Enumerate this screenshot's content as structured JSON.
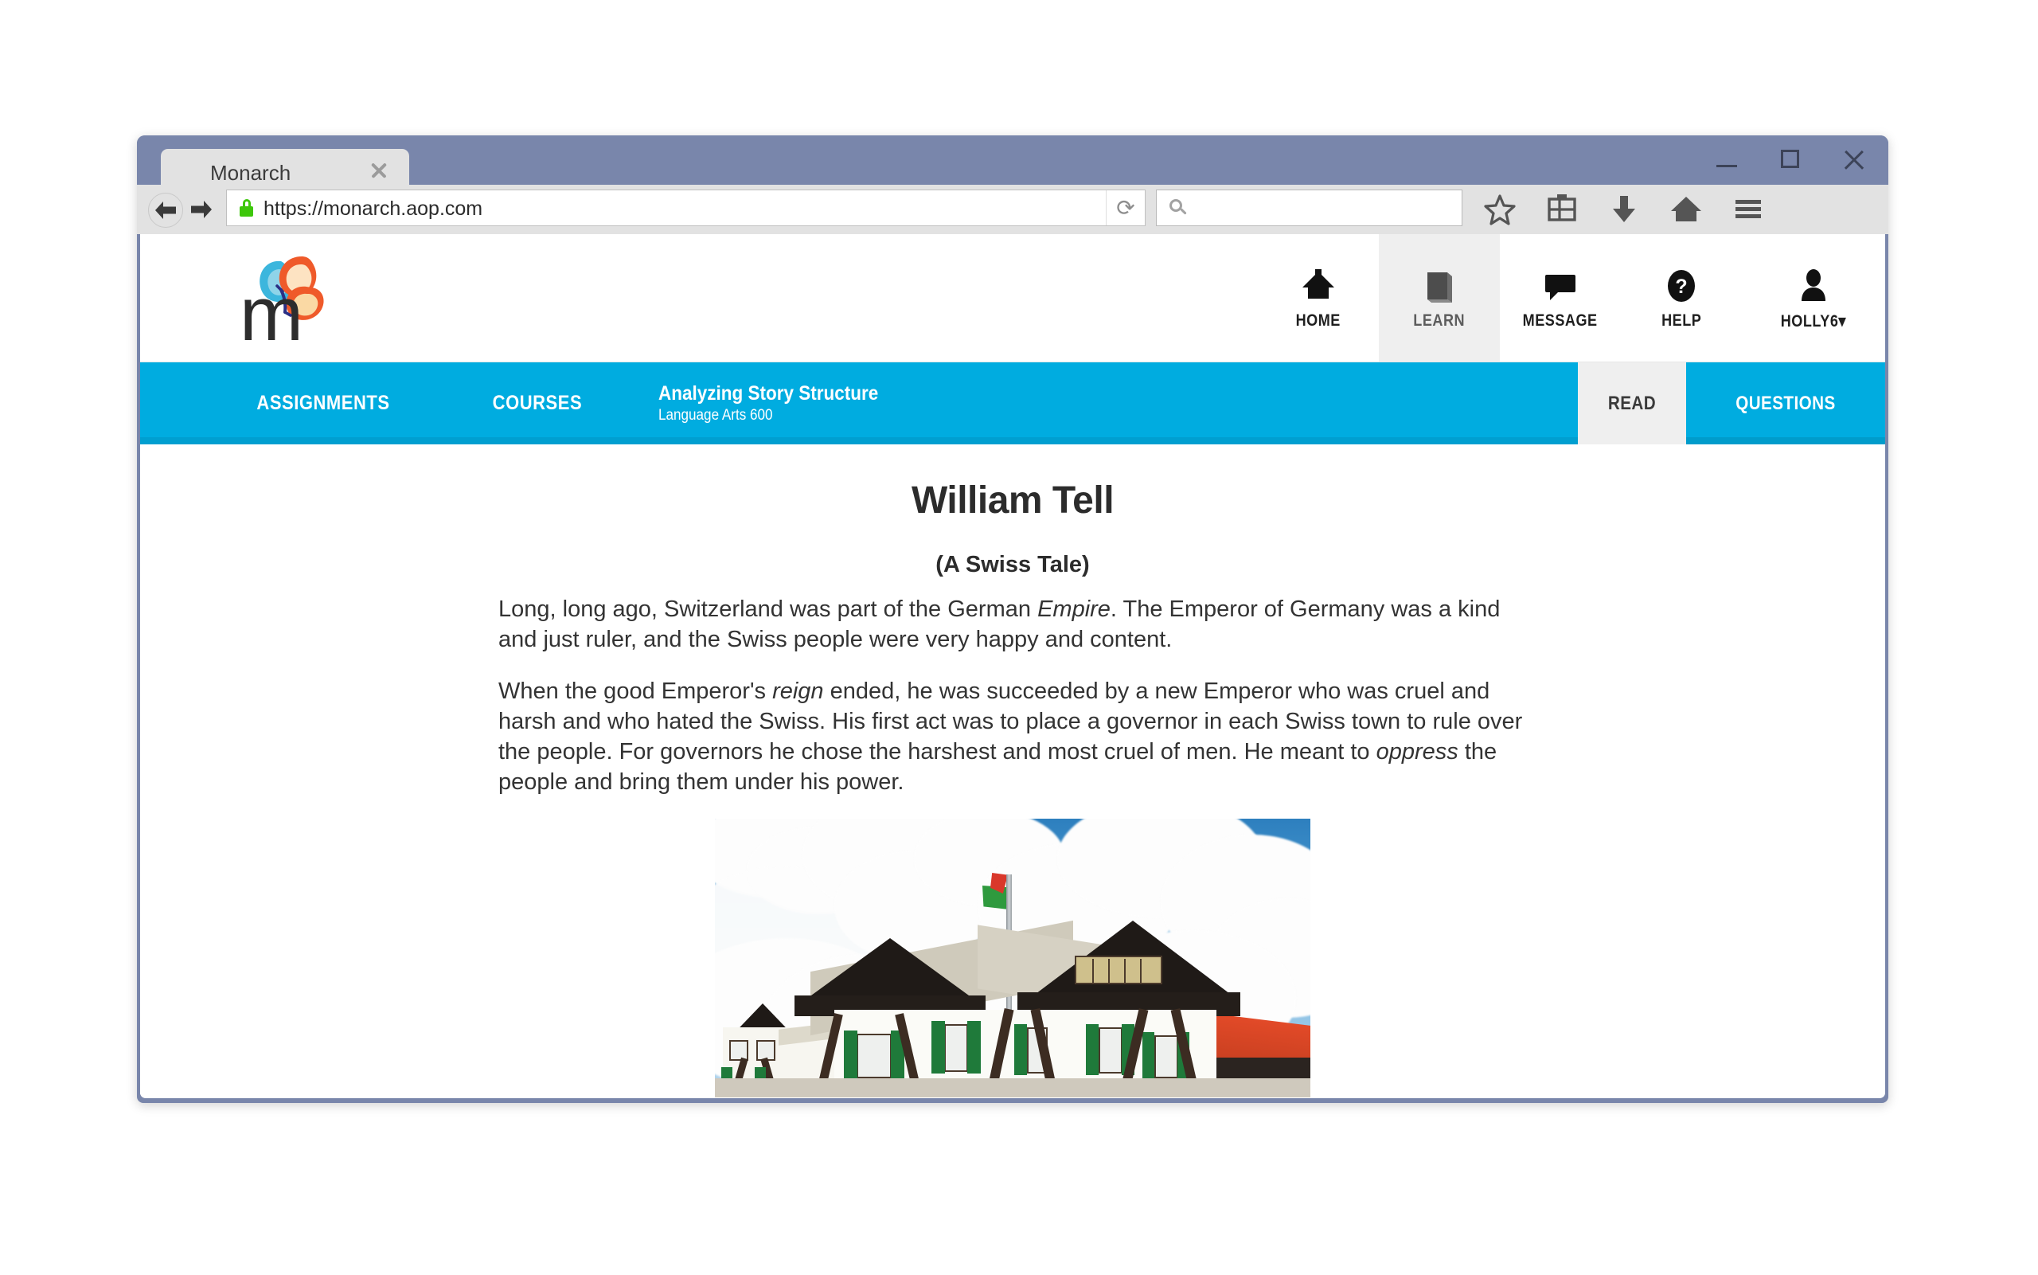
{
  "browser": {
    "tab": {
      "title": "Monarch",
      "close_icon": "close-icon"
    },
    "window_controls": {
      "minimize": "minimize-icon",
      "maximize": "maximize-icon",
      "close": "close-icon"
    },
    "navigation": {
      "back_icon": "back-arrow-icon",
      "forward_icon": "forward-arrow-icon",
      "reload_icon": "reload-icon"
    },
    "address_bar": {
      "url": "https://monarch.aop.com",
      "lock_icon": "lock-icon",
      "secure": "Secure"
    },
    "search": {
      "value": "",
      "placeholder": "",
      "icon": "search-icon"
    },
    "toolbar_icons": [
      "bookmark-star-icon",
      "library-icon",
      "download-icon",
      "home-icon",
      "menu-icon"
    ]
  },
  "site": {
    "logo": {
      "letter": "m",
      "icon": "butterfly-icon",
      "brand": "Monarch"
    },
    "header_nav": [
      {
        "label": "HOME",
        "icon": "home-icon",
        "active": false
      },
      {
        "label": "LEARN",
        "icon": "book-icon",
        "active": true
      },
      {
        "label": "MESSAGE",
        "icon": "message-bubble-icon",
        "active": false
      },
      {
        "label": "HELP",
        "icon": "question-circle-icon",
        "active": false
      },
      {
        "label": "HOLLY6",
        "icon": "user-icon",
        "active": false,
        "caret": "▾"
      }
    ],
    "course_bar": {
      "links": [
        {
          "label": "ASSIGNMENTS"
        },
        {
          "label": "COURSES"
        }
      ],
      "course_title": "Analyzing Story Structure",
      "course_subtitle": "Language Arts 600",
      "tabs": [
        {
          "label": "READ",
          "active": false
        },
        {
          "label": "QUESTIONS",
          "active": true
        }
      ]
    },
    "colors": {
      "accent_blue": "#00ace0",
      "titlebar": "#7986ab",
      "toolbar": "#e2e2e2",
      "active_tab_gray": "#efefef",
      "lock_green": "#3ec70b"
    }
  },
  "article": {
    "title": "William Tell",
    "subtitle": "(A Swiss Tale)",
    "paragraphs": [
      {
        "parts": [
          {
            "t": "Long, long ago, Switzerland was part of the German ",
            "i": false
          },
          {
            "t": "Empire",
            "i": true
          },
          {
            "t": ". The Emperor of Germany was a kind and just ruler, and the Swiss people were very happy and content.",
            "i": false
          }
        ]
      },
      {
        "parts": [
          {
            "t": "When the good Emperor's ",
            "i": false
          },
          {
            "t": "reign",
            "i": true
          },
          {
            "t": " ended, he was succeeded by a new Emperor who was cruel and harsh and who hated the Swiss. His first act was to place a governor in each Swiss town to rule over the people. For governors he chose the harshest and most cruel of men. He meant to ",
            "i": false
          },
          {
            "t": "oppress",
            "i": true
          },
          {
            "t": " the people and bring them under his power.",
            "i": false
          }
        ]
      }
    ],
    "figure": {
      "name": "swiss-chalet-photo",
      "description": "Photograph of a traditional Swiss chalet with dark timber framing, white walls, green shutters, a flagpole with the Swiss-style flag, and a red-roofed building at right under a blue sky with large white clouds."
    }
  }
}
